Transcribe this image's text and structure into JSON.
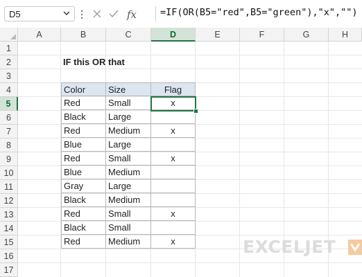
{
  "formula_bar": {
    "name_box": "D5",
    "formula": "=IF(OR(B5=\"red\",B5=\"green\"),\"x\",\"\")"
  },
  "columns": [
    "A",
    "B",
    "C",
    "D",
    "E",
    "F",
    "G",
    "H"
  ],
  "rows": [
    "1",
    "2",
    "3",
    "4",
    "5",
    "6",
    "7",
    "8",
    "9",
    "10",
    "11",
    "12",
    "13",
    "14",
    "15",
    "16",
    "17"
  ],
  "sheet": {
    "title": "IF this OR that",
    "table": {
      "headers": [
        "Color",
        "Size",
        "Flag"
      ],
      "rows": [
        [
          "Red",
          "Small",
          "x"
        ],
        [
          "Black",
          "Large",
          ""
        ],
        [
          "Red",
          "Medium",
          "x"
        ],
        [
          "Blue",
          "Large",
          ""
        ],
        [
          "Red",
          "Small",
          "x"
        ],
        [
          "Blue",
          "Medium",
          ""
        ],
        [
          "Gray",
          "Large",
          ""
        ],
        [
          "Black",
          "Medium",
          ""
        ],
        [
          "Red",
          "Small",
          "x"
        ],
        [
          "Black",
          "Small",
          ""
        ],
        [
          "Red",
          "Medium",
          "x"
        ]
      ]
    }
  },
  "logo": {
    "text": "EXCELJET"
  },
  "colors": {
    "accent": "#217346",
    "header_fill": "#dce6f1",
    "logo_mark": "#f6c9a0"
  }
}
